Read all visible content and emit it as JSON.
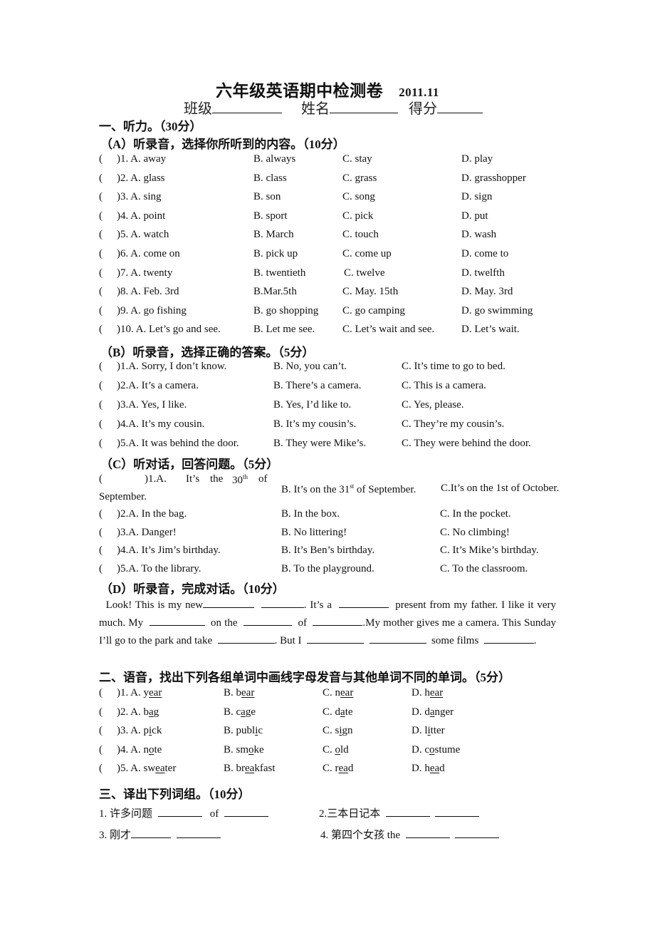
{
  "header": {
    "title": "六年级英语期中检测卷",
    "date": "2011.11",
    "class_label": "班级",
    "name_label": "姓名",
    "score_label": "得分"
  },
  "section1": {
    "heading": "一、听力。（30分）",
    "partA": {
      "heading": "（A）听录音，选择你所听到的内容。（10分）",
      "items": [
        {
          "num": ")1. A. away",
          "b": "B. always",
          "c": "C. stay",
          "d": "D. play"
        },
        {
          "num": ")2. A. glass",
          "b": "B. class",
          "c": "C. grass",
          "d": "D. grasshopper"
        },
        {
          "num": ")3. A. sing",
          "b": "B. son",
          "c": "C. song",
          "d": "D. sign"
        },
        {
          "num": ")4. A. point",
          "b": "B. sport",
          "c": "C. pick",
          "d": "D. put"
        },
        {
          "num": ")5. A. watch",
          "b": "B. March",
          "c": "C. touch",
          "d": "D. wash"
        },
        {
          "num": ")6. A. come on",
          "b": "B. pick up",
          "c": "C. come up",
          "d": "D. come to"
        },
        {
          "num": ")7. A. twenty",
          "b": "B. twentieth",
          "c": "C. twelve",
          "d": "D. twelfth"
        },
        {
          "num": ")8. A. Feb. 3rd",
          "b": "B.Mar.5th",
          "c": "C. May. 15th",
          "d": "D. May. 3rd"
        },
        {
          "num": ")9. A. go fishing",
          "b": "B. go shopping",
          "c": "C. go camping",
          "d": "D. go swimming"
        },
        {
          "num": ")10. A. Let’s go and see.",
          "b": "B. Let me see.",
          "c": "C. Let’s wait and see.",
          "d": "D. Let’s wait."
        }
      ]
    },
    "partB": {
      "heading": "（B）听录音，选择正确的答案。（5分）",
      "items": [
        {
          "num": ")1.A. Sorry, I don’t know.",
          "b": "B. No, you can’t.",
          "c": "C. It’s time to go to bed."
        },
        {
          "num": ")2.A. It’s a camera.",
          "b": "B. There’s a camera.",
          "c": "C. This is a camera."
        },
        {
          "num": ")3.A. Yes, I like.",
          "b": "B. Yes, I’d like to.",
          "c": "C. Yes, please."
        },
        {
          "num": ")4.A. It’s my cousin.",
          "b": "B. It’s my cousin’s.",
          "c": "C. They’re my cousin’s."
        },
        {
          "num": ")5.A. It was behind the door.",
          "b": "B. They were Mike’s.",
          "c": "C. They were behind the door."
        }
      ]
    },
    "partC": {
      "heading": "（C）听对话，回答问题。（5分）",
      "item1": {
        "num": ")1.A.",
        "a_words": [
          "It’s",
          "the",
          "30",
          "th",
          "of"
        ],
        "a_cont": "September.",
        "b_pre": "B. It’s on the 31",
        "b_sup": "st",
        "b_post": " of September.",
        "c": "C.It’s on the 1st of October."
      },
      "items": [
        {
          "num": ")2.A. In the bag.",
          "b": "B. In the box.",
          "c": "C. In the pocket."
        },
        {
          "num": ")3.A. Danger!",
          "b": "B. No littering!",
          "c": "C. No climbing!"
        },
        {
          "num": ")4.A. It’s Jim’s birthday.",
          "b": "B. It’s Ben’s birthday.",
          "c": "C. It’s Mike’s birthday."
        },
        {
          "num": ")5.A. To the library.",
          "b": "B. To the playground.",
          "c": "C. To the classroom."
        }
      ]
    },
    "partD": {
      "heading": "（D）听录音，完成对话。（10分）",
      "t1": "Look! This is my new",
      "t2": ". It’s a",
      "t3": "present from my father. I like it very much.  My",
      "t4": "on the",
      "t5": "of",
      "t6": ".My mother gives me a camera. This Sunday I’ll go to the park and take",
      "t7": ". But I",
      "t8": "some films",
      "t9": "."
    }
  },
  "section2": {
    "heading": "二、语音，找出下列各组单词中画线字母发音与其他单词不同的单词。（5分）",
    "items": [
      {
        "num": ")1. A. ",
        "a": [
          "y",
          "ear",
          ""
        ],
        "b": [
          "B. b",
          "ear",
          ""
        ],
        "c": [
          "C. n",
          "ear",
          ""
        ],
        "d": [
          "D. h",
          "ear",
          ""
        ]
      },
      {
        "num": ")2. A. ",
        "a": [
          "b",
          "a",
          "g"
        ],
        "b": [
          "B. c",
          "a",
          "ge"
        ],
        "c": [
          "C. d",
          "a",
          "te"
        ],
        "d": [
          "D. d",
          "a",
          "nger"
        ]
      },
      {
        "num": ")3. A. ",
        "a": [
          "p",
          "i",
          "ck"
        ],
        "b": [
          "B. publ",
          "i",
          "c"
        ],
        "c": [
          "C. s",
          "i",
          "gn"
        ],
        "d": [
          "D. l",
          "i",
          "tter"
        ]
      },
      {
        "num": ")4. A. ",
        "a": [
          "n",
          "o",
          "te"
        ],
        "b": [
          "B. sm",
          "o",
          "ke"
        ],
        "c": [
          "C. ",
          "o",
          "ld"
        ],
        "d": [
          "D. c",
          "o",
          "stume"
        ]
      },
      {
        "num": ")5. A. ",
        "a": [
          "sw",
          "ea",
          "ter"
        ],
        "b": [
          "B. br",
          "ea",
          "kfast"
        ],
        "c": [
          "C. r",
          "ea",
          "d"
        ],
        "d": [
          "D. h",
          "ea",
          "d"
        ]
      }
    ]
  },
  "section3": {
    "heading": "三、译出下列词组。（10分）",
    "items": [
      {
        "label": "1.  许多问题",
        "mid": "of"
      },
      {
        "label": "2.三本日记本",
        "mid": ""
      },
      {
        "label": "3.  刚才",
        "mid": ""
      },
      {
        "label": "4.  第四个女孩  the",
        "mid": ""
      }
    ]
  }
}
